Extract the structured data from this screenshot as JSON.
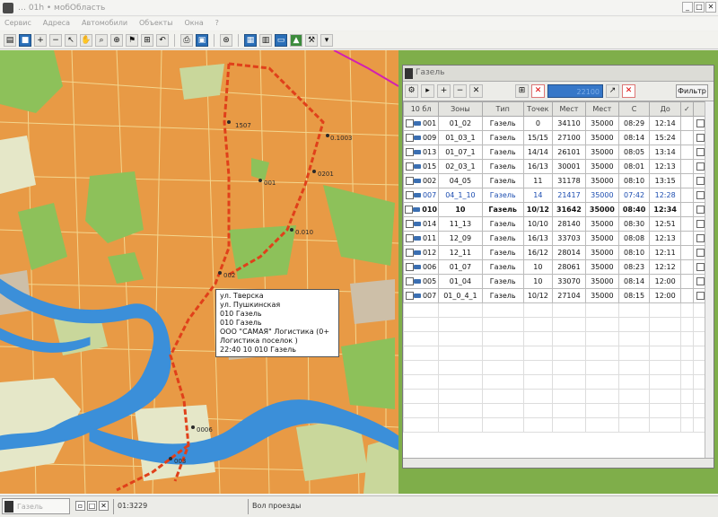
{
  "window": {
    "title": "… 01h • мобОбласть",
    "min": "_",
    "max": "□",
    "close": "✕"
  },
  "menu": [
    "Сервис",
    "Адреса",
    "Автомобили",
    "Объекты",
    "Окна",
    "?"
  ],
  "map": {
    "route_color": "#e0401a",
    "tooltip_lines": [
      "ул. Тверска",
      "ул. Пушкинская",
      "010  Газель",
      "010  Газель",
      "ООО \"САМАЯ\" Логистика (0+",
      "Логистика поселок )",
      "22:40 10  010  Газель"
    ],
    "labels": [
      "1507",
      "0.1003",
      "0201",
      "001",
      "0.010",
      "002",
      "0006",
      "003"
    ]
  },
  "panel": {
    "title": "Газель",
    "counter": "22100",
    "filter_label": "Фильтр",
    "columns": [
      "10 бл",
      "Зоны",
      "Тип",
      "Точек",
      "Мест",
      "Мест",
      "С",
      "До",
      "",
      ""
    ],
    "rows": [
      {
        "id": "001",
        "zone": "01_02",
        "type": "Газель",
        "pts": "0",
        "a": "34110",
        "b": "35000",
        "from": "08:29",
        "to": "12:14",
        "cls": ""
      },
      {
        "id": "009",
        "zone": "01_03_1",
        "type": "Газель",
        "pts": "15/15",
        "a": "27100",
        "b": "35000",
        "from": "08:14",
        "to": "15:24",
        "cls": ""
      },
      {
        "id": "013",
        "zone": "01_07_1",
        "type": "Газель",
        "pts": "14/14",
        "a": "26101",
        "b": "35000",
        "from": "08:05",
        "to": "13:14",
        "cls": ""
      },
      {
        "id": "015",
        "zone": "02_03_1",
        "type": "Газель",
        "pts": "16/13",
        "a": "30001",
        "b": "35000",
        "from": "08:01",
        "to": "12:13",
        "cls": ""
      },
      {
        "id": "002",
        "zone": "04_05",
        "type": "Газель",
        "pts": "11",
        "a": "31178",
        "b": "35000",
        "from": "08:10",
        "to": "13:15",
        "cls": ""
      },
      {
        "id": "007",
        "zone": "04_1_10",
        "type": "Газель",
        "pts": "14",
        "a": "21417",
        "b": "35000",
        "from": "07:42",
        "to": "12:28",
        "cls": "blue"
      },
      {
        "id": "010",
        "zone": "10",
        "type": "Газель",
        "pts": "10/12",
        "a": "31642",
        "b": "35000",
        "from": "08:40",
        "to": "12:34",
        "cls": "sel"
      },
      {
        "id": "014",
        "zone": "11_13",
        "type": "Газель",
        "pts": "10/10",
        "a": "28140",
        "b": "35000",
        "from": "08:30",
        "to": "12:51",
        "cls": ""
      },
      {
        "id": "011",
        "zone": "12_09",
        "type": "Газель",
        "pts": "16/13",
        "a": "33703",
        "b": "35000",
        "from": "08:08",
        "to": "12:13",
        "cls": ""
      },
      {
        "id": "012",
        "zone": "12_11",
        "type": "Газель",
        "pts": "16/12",
        "a": "28014",
        "b": "35000",
        "from": "08:10",
        "to": "12:11",
        "cls": ""
      },
      {
        "id": "006",
        "zone": "01_07",
        "type": "Газель",
        "pts": "10",
        "a": "28061",
        "b": "35000",
        "from": "08:23",
        "to": "12:12",
        "cls": ""
      },
      {
        "id": "005",
        "zone": "01_04",
        "type": "Газель",
        "pts": "10",
        "a": "33070",
        "b": "35000",
        "from": "08:14",
        "to": "12:00",
        "cls": ""
      },
      {
        "id": "007",
        "zone": "01_0_4_1",
        "type": "Газель",
        "pts": "10/12",
        "a": "27104",
        "b": "35000",
        "from": "08:15",
        "to": "12:00",
        "cls": ""
      }
    ]
  },
  "status": {
    "window_label": "Газель",
    "coord": "01:3229",
    "mode": "Вол проезды"
  }
}
